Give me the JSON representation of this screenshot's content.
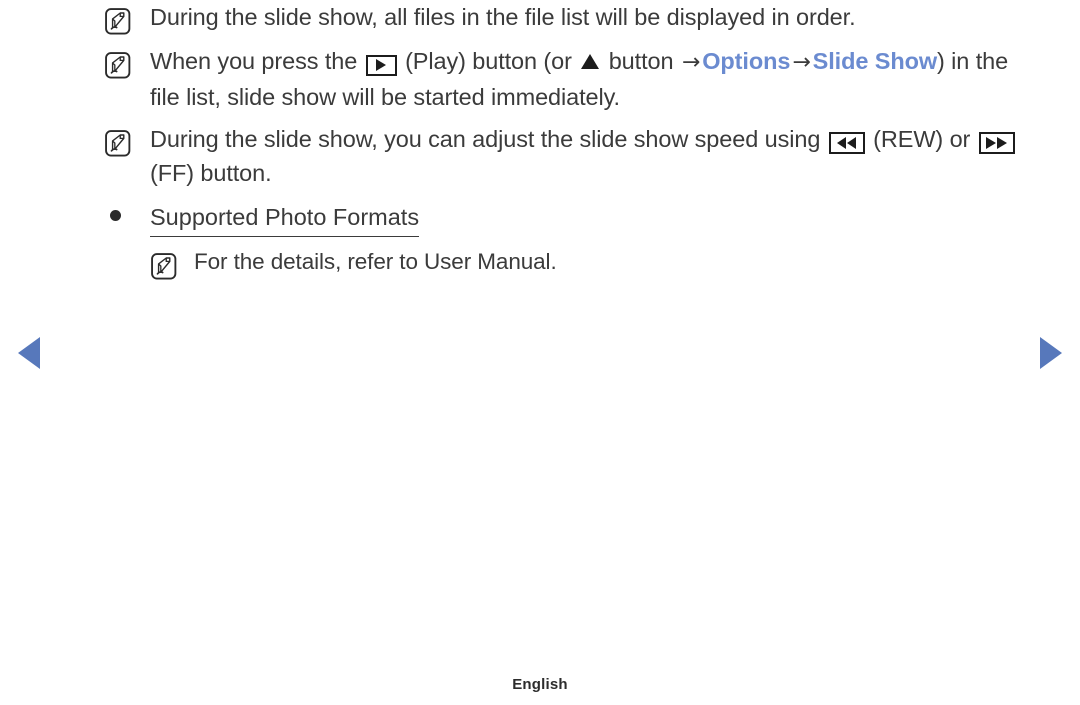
{
  "document": {
    "footer_language": "English"
  },
  "notes": [
    {
      "icon": "note-icon",
      "segments": [
        {
          "type": "text",
          "value": "During the slide show, all files in the file list will be displayed in order."
        }
      ]
    },
    {
      "icon": "note-icon",
      "segments": [
        {
          "type": "text",
          "value": "When you press the "
        },
        {
          "type": "keybox-play",
          "value": "play-button-glyph"
        },
        {
          "type": "text",
          "value": " (Play) button (or "
        },
        {
          "type": "tri-up",
          "value": "up-arrow-glyph"
        },
        {
          "type": "text",
          "value": " button "
        },
        {
          "type": "arrow",
          "value": "→"
        },
        {
          "type": "blue",
          "value": "Options"
        },
        {
          "type": "arrow",
          "value": "→"
        },
        {
          "type": "blue",
          "value": "Slide Show"
        },
        {
          "type": "text",
          "value": ") in the file list, slide show will be started immediately."
        }
      ]
    },
    {
      "icon": "note-icon",
      "segments": [
        {
          "type": "text",
          "value": "During the slide show, you can adjust the slide show speed using "
        },
        {
          "type": "keybox-rew",
          "value": "rewind-button-glyph"
        },
        {
          "type": "text",
          "value": " (REW) or "
        },
        {
          "type": "keybox-ff",
          "value": "fast-forward-button-glyph"
        },
        {
          "type": "text",
          "value": " (FF) button."
        }
      ]
    }
  ],
  "bullet": {
    "label": "Supported Photo Formats",
    "sub_note": {
      "icon": "note-icon",
      "text": "For the details, refer to User Manual."
    }
  },
  "navigation": {
    "prev_label": "previous-page",
    "next_label": "next-page"
  },
  "colors": {
    "accent_blue": "#6b8bd0",
    "nav_blue": "#5778bb",
    "body_text": "#3b3b3b"
  },
  "text_pieces": {
    "note1": "During the slide show, all files in the file list will be displayed in order.",
    "note2_a": "When you press the ",
    "note2_b": " (Play) button (or ",
    "note2_c": " button ",
    "note2_arrow1": "→",
    "note2_options": "Options",
    "note2_arrow2": "→",
    "note2_slideshow": "Slide Show",
    "note2_d": ") in the file list, slide show will be started immediately.",
    "note3_a": "During the slide show, you can adjust the slide show speed using ",
    "note3_b": " (REW) or ",
    "note3_c": " (FF) button.",
    "bullet_label": "Supported Photo Formats",
    "subnote_text": "For the details, refer to User Manual."
  }
}
